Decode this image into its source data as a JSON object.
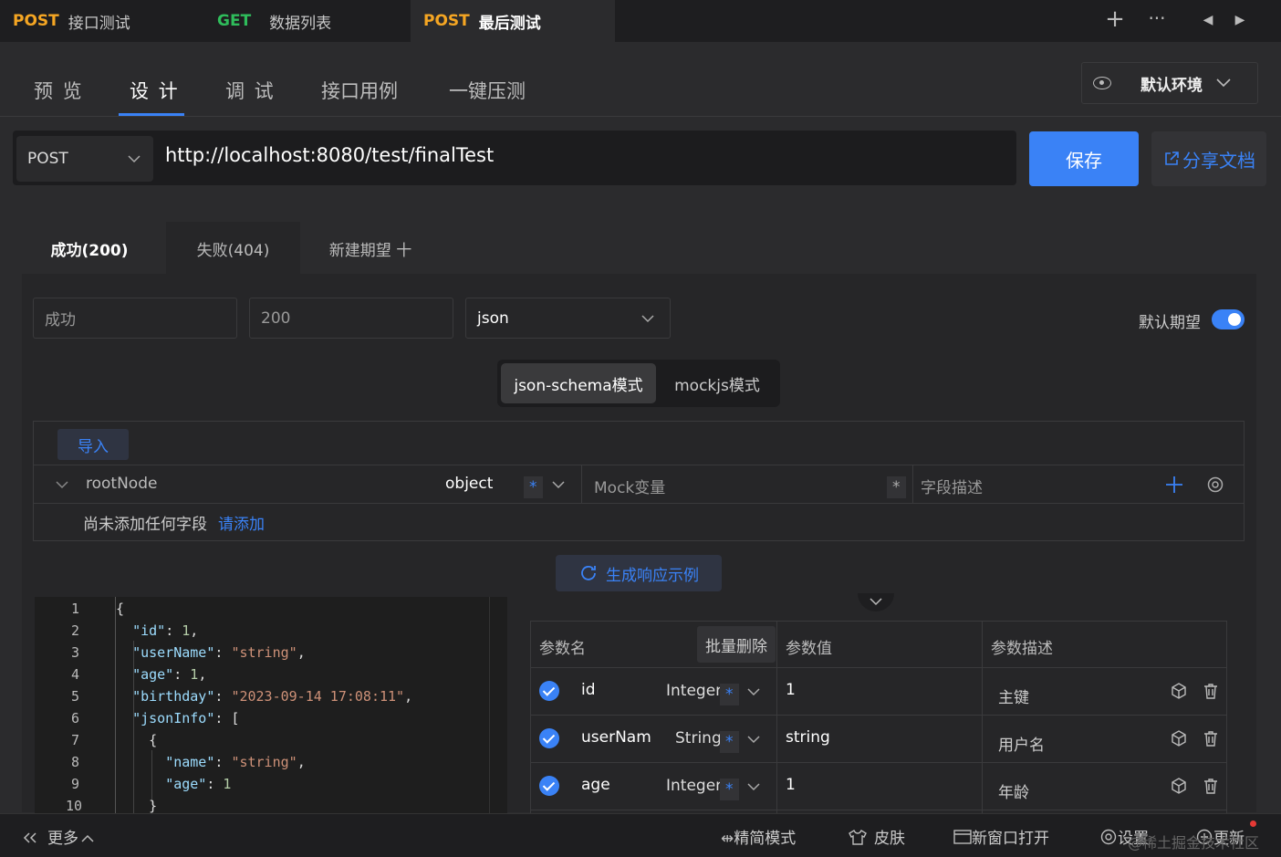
{
  "tabs": [
    {
      "method": "POST",
      "title": "接口测试"
    },
    {
      "method": "GET",
      "title": "数据列表"
    },
    {
      "method": "POST",
      "title": "最后测试"
    }
  ],
  "tab_actions": {
    "add": "+",
    "more": "···",
    "prev": "◀",
    "next": "▶"
  },
  "subnav": [
    "预 览",
    "设 计",
    "调 试",
    "接口用例",
    "一键压测"
  ],
  "env": {
    "label": "默认环境"
  },
  "request": {
    "method": "POST",
    "url": "http://localhost:8080/test/finalTest"
  },
  "buttons": {
    "save": "保存",
    "share": "分享文档"
  },
  "expect_tabs": [
    "成功(200)",
    "失败(404)",
    "新建期望 十"
  ],
  "expect": {
    "name": "成功",
    "code": "200",
    "format": "json",
    "default_label": "默认期望",
    "default_on": true
  },
  "modes": [
    "json-schema模式",
    "mockjs模式"
  ],
  "schema": {
    "import": "导入",
    "root": {
      "name": "rootNode",
      "type": "object",
      "required": "*",
      "mock_placeholder": "Mock变量",
      "mock_required": "*",
      "desc_placeholder": "字段描述"
    },
    "empty_text": "尚未添加任何字段",
    "empty_link": "请添加"
  },
  "generate": "生成响应示例",
  "code_lines": [
    "1",
    "2",
    "3",
    "4",
    "5",
    "6",
    "7",
    "8",
    "9",
    "10"
  ],
  "params": {
    "headers": {
      "name": "参数名",
      "batch_delete": "批量删除",
      "value": "参数值",
      "desc": "参数描述"
    },
    "rows": [
      {
        "name": "id",
        "type": "Integer",
        "value": "1",
        "desc": "主键"
      },
      {
        "name": "userNam",
        "type": "String",
        "value": "string",
        "desc": "用户名"
      },
      {
        "name": "age",
        "type": "Integer",
        "value": "1",
        "desc": "年龄"
      }
    ]
  },
  "footer": {
    "more": "更多",
    "simple": "精简模式",
    "skin": "皮肤",
    "new_window": "新窗口打开",
    "settings": "设置",
    "update": "更新"
  },
  "watermark": "@稀土掘金技术社区",
  "colors": {
    "accent": "#3a82f6",
    "post": "#f5a623",
    "get": "#2fbd5b"
  }
}
